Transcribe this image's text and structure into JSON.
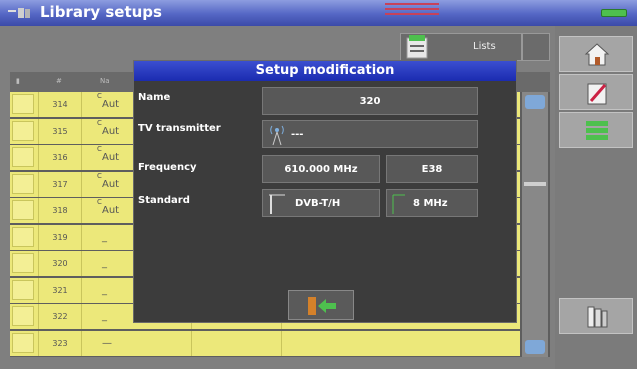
{
  "app": {
    "title": "Library setups"
  },
  "colors": {
    "titlebar": "#5466c4",
    "modal_title": "#1b2bb0",
    "row_yellow": "#ece87a",
    "battery": "#4ec04e",
    "status_red": "#c7425a"
  },
  "tabs": {
    "lists_label": "Lists"
  },
  "table": {
    "rows": [
      {
        "num": "314",
        "name": "Aut",
        "small": "C"
      },
      {
        "num": "315",
        "name": "Aut",
        "small": "C"
      },
      {
        "num": "316",
        "name": "Aut",
        "small": "C"
      },
      {
        "num": "317",
        "name": "Aut",
        "small": "C"
      },
      {
        "num": "318",
        "name": "Aut",
        "small": "C"
      },
      {
        "num": "319",
        "name": "_",
        "small": ""
      },
      {
        "num": "320",
        "name": "_",
        "small": ""
      },
      {
        "num": "321",
        "name": "_",
        "small": ""
      },
      {
        "num": "322",
        "name": "_",
        "small": ""
      },
      {
        "num": "323",
        "name": "—",
        "small": ""
      }
    ]
  },
  "modal": {
    "title": "Setup modification",
    "name_label": "Name",
    "name_value": "320",
    "tv_label": "TV transmitter",
    "tv_value": "---",
    "frequency_label": "Frequency",
    "frequency_value": "610.000 MHz",
    "channel_value": "E38",
    "standard_label": "Standard",
    "standard_value": "DVB-T/H",
    "bandwidth_value": "8 MHz"
  },
  "icons": {
    "home": "home-icon",
    "edit": "edit-icon",
    "list_setup": "list-setup-icon",
    "library": "library-icon",
    "exit": "exit-icon",
    "antenna": "antenna-icon"
  }
}
